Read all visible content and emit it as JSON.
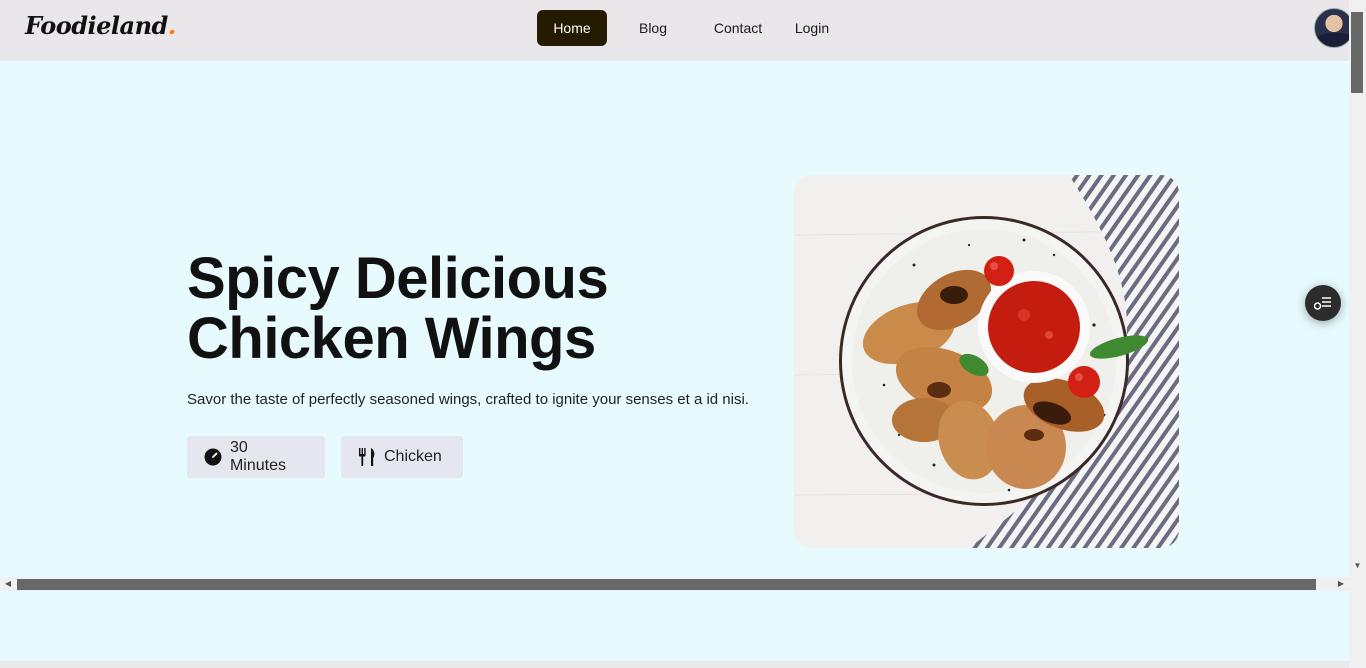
{
  "header": {
    "logo": "Foodieland",
    "logo_dot": ".",
    "nav": [
      {
        "label": "Home",
        "active": true
      },
      {
        "label": "Blog",
        "active": false
      },
      {
        "label": "Contact",
        "active": false
      },
      {
        "label": "Login",
        "active": false
      }
    ]
  },
  "hero": {
    "title_line1": "Spicy Delicious",
    "title_line2": "Chicken Wings",
    "description": "Savor the taste of perfectly seasoned wings, crafted to ignite your senses et a id nisi.",
    "chips": [
      {
        "label": "30 Minutes",
        "icon": "timer-icon"
      },
      {
        "label": "Chicken",
        "icon": "fork-knife-icon"
      }
    ]
  },
  "colors": {
    "active_nav_bg": "#231a00",
    "hero_bg": "#e7fbff",
    "header_bg": "#e9e7e9",
    "logo_dot": "#ff7a00"
  },
  "floating_button": {
    "icon": "filter-list-icon"
  }
}
